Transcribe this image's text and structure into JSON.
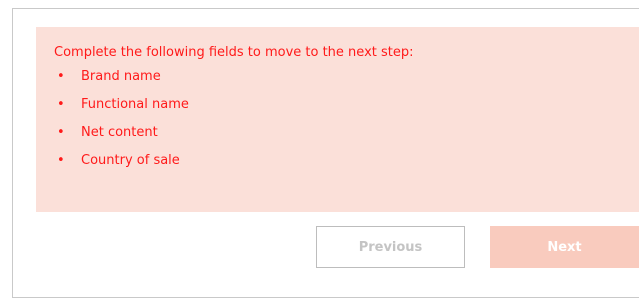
{
  "alert": {
    "title": "Complete the following fields to move to the next step:",
    "bullet_glyph": "•",
    "items": [
      {
        "label": "Brand name"
      },
      {
        "label": "Functional name"
      },
      {
        "label": "Net content"
      },
      {
        "label": "Country of sale"
      }
    ],
    "text_color": "#ff1a1a",
    "background_color": "#fbe0d9"
  },
  "actions": {
    "previous_label": "Previous",
    "next_label": "Next",
    "next_background_color": "#f9cbbe"
  }
}
